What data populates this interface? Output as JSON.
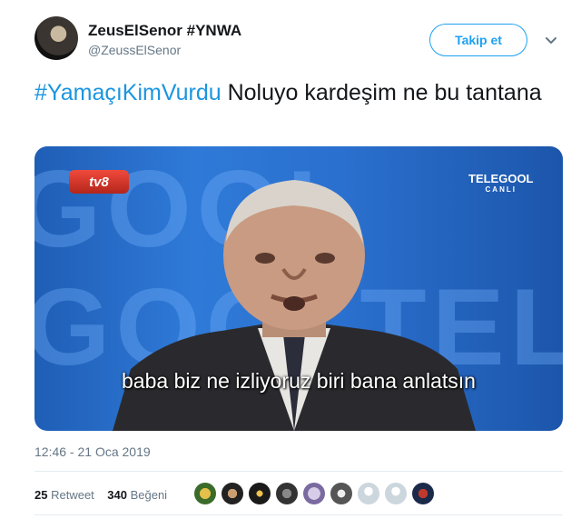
{
  "author": {
    "name": "ZeusElSenor #YNWA",
    "handle": "@ZeussElSenor"
  },
  "follow_button": {
    "label": "Takip et"
  },
  "menu": {
    "icon": "chevron-down-icon"
  },
  "tweet": {
    "hashtag": "#YamaçıKimVurdu",
    "text": " Noluyo kardeşim ne bu tantana"
  },
  "media": {
    "channel_logo": "tv8",
    "tele_logo": "TELEGOOL",
    "tele_logo_sub": "CANLI",
    "subtitle": "baba biz ne izliyoruz biri bana anlatsın"
  },
  "timestamp": "12:46 - 21 Oca 2019",
  "stats": {
    "retweet_count": "25",
    "retweet_label": "Retweet",
    "like_count": "340",
    "like_label": "Beğeni"
  },
  "colors": {
    "accent": "#1da1f2",
    "hashtag": "#1b95e0",
    "muted": "#657786"
  },
  "likers": [
    "avatar-1",
    "avatar-2",
    "avatar-3",
    "avatar-4",
    "avatar-5",
    "avatar-6",
    "avatar-7",
    "avatar-8",
    "avatar-9"
  ]
}
